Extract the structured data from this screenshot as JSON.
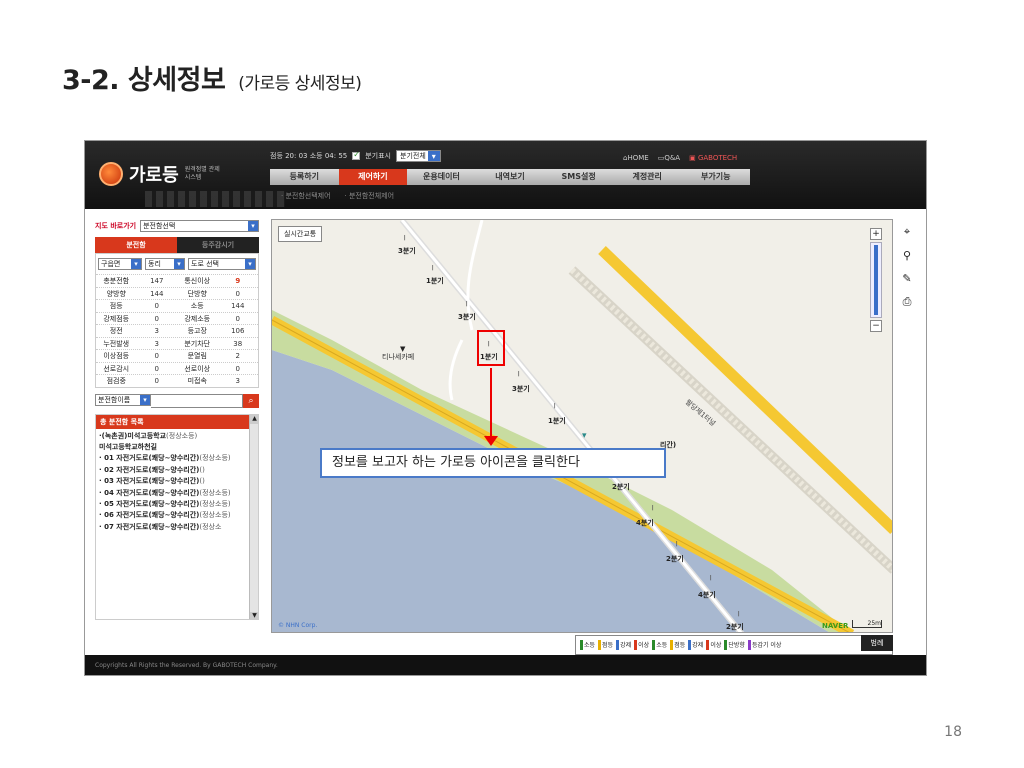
{
  "slide": {
    "title": "3-2. 상세정보",
    "subtitle": "(가로등 상세정보)",
    "page_number": "18"
  },
  "app": {
    "logo_text": "가로등",
    "logo_sub": "원격점멸 관제시스템",
    "status": {
      "time_text": "점등 20: 03 소등 04: 55",
      "quarter_toggle_label": "분기표시",
      "quarter_select_value": "분기전체"
    },
    "top_links": {
      "home": "HOME",
      "qa": "Q&A",
      "brand": "GABOTECH"
    },
    "nav": [
      "등록하기",
      "제어하기",
      "운용데이터",
      "내역보기",
      "SMS설정",
      "계정관리",
      "부가기능"
    ],
    "nav_active_index": 1,
    "subnav": [
      "· 분전함선택제어",
      "· 분전함전체제어"
    ]
  },
  "sidebar": {
    "shortcut_label": "지도 바로가기",
    "shortcut_select": "분전함선택",
    "tabs": [
      "분전함",
      "등주감시기"
    ],
    "filters": [
      "구읍면",
      "동리",
      "도로 선택"
    ],
    "stats": [
      [
        "총분전함",
        "147",
        "통신이상",
        "9"
      ],
      [
        "양방향",
        "144",
        "단방향",
        "0"
      ],
      [
        "점등",
        "0",
        "소등",
        "144"
      ],
      [
        "강제점등",
        "0",
        "강제소등",
        "0"
      ],
      [
        "정전",
        "3",
        "등고장",
        "106"
      ],
      [
        "누전발생",
        "3",
        "분기차단",
        "38"
      ],
      [
        "이상점등",
        "0",
        "문열림",
        "2"
      ],
      [
        "선로감시",
        "0",
        "선로이상",
        "0"
      ],
      [
        "점검중",
        "0",
        "미접속",
        "3"
      ]
    ],
    "search_select": "분전함이름",
    "search_value": "",
    "list_header": "총 분전함 목록",
    "list_items": [
      {
        "name": "·(녹촌권)미석고등학교",
        "detail": "(정상소등)"
      },
      {
        "name": "미석고등학교하천길",
        "detail": ""
      },
      {
        "name": "· 01 자전거도로(쾌당~양수리간)",
        "detail": "(정상소등)"
      },
      {
        "name": "· 02 자전거도로(쾌당~양수리간)",
        "detail": "()"
      },
      {
        "name": "· 03 자전거도로(쾌당~양수리간)",
        "detail": "()"
      },
      {
        "name": "· 04 자전거도로(쾌당~양수리간)",
        "detail": "(정상소등)"
      },
      {
        "name": "· 05 자전거도로(쾌당~양수리간)",
        "detail": "(정상소등)"
      },
      {
        "name": "· 06 자전거도로(쾌당~양수리간)",
        "detail": "(정상소등)"
      },
      {
        "name": "· 07 자전거도로(쾌당~양수리간)",
        "detail": "(정상소"
      }
    ]
  },
  "map": {
    "realtime_button": "실시간교통",
    "cafe_label": "티나세카페",
    "road_label": "팔당제1터널",
    "partial_label": "리간)",
    "lamps": [
      "3분기",
      "1분기",
      "3분기",
      "1분기",
      "3분기",
      "1분기",
      "2분기",
      "4분기",
      "2분기",
      "4분기",
      "2분기"
    ],
    "callout": "정보를 보고자 하는 가로등 아이콘을 클릭한다",
    "copyright": "© NHN Corp.",
    "naver": "NAVER",
    "scale": "25m"
  },
  "legend": {
    "items": [
      {
        "label": "소등",
        "color": "#2a8a2a"
      },
      {
        "label": "점등",
        "color": "#e8b000"
      },
      {
        "label": "강제",
        "color": "#3a6fc8"
      },
      {
        "label": "이상",
        "color": "#d8381c"
      },
      {
        "label": "소등",
        "color": "#2a8a2a"
      },
      {
        "label": "점등",
        "color": "#e8b000"
      },
      {
        "label": "강제",
        "color": "#3a6fc8"
      },
      {
        "label": "이상",
        "color": "#d8381c"
      },
      {
        "label": "단방향",
        "color": "#2a8a2a"
      },
      {
        "label": "등감기 이상",
        "color": "#8a3ac8"
      }
    ],
    "button": "범례"
  },
  "footer": "Copyrights All Rights the Reserved. By GABOTECH Company.",
  "colors": {
    "accent": "#d8381c",
    "callout_border": "#4a7ac8",
    "highlight": "#e00000",
    "water": "#a8b8d0",
    "road": "#f5c832"
  }
}
